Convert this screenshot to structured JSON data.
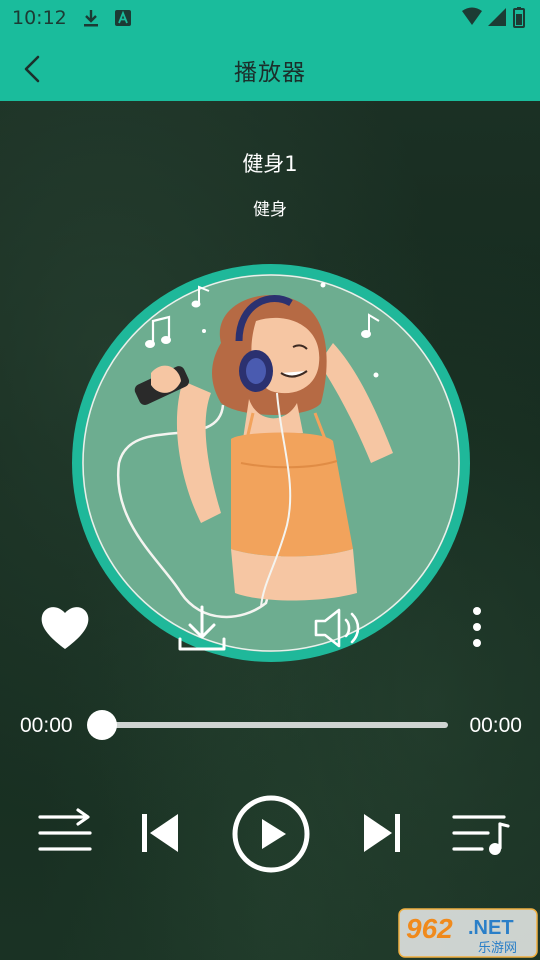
{
  "status_bar": {
    "time": "10:12",
    "icons": [
      "download-icon",
      "a-badge-icon",
      "wifi-icon",
      "signal-icon",
      "battery-icon"
    ]
  },
  "app_bar": {
    "title": "播放器",
    "back_icon": "chevron-left-icon"
  },
  "song": {
    "title": "健身1",
    "artist": "健身"
  },
  "actions": [
    "heart-icon",
    "download-icon",
    "volume-icon",
    "more-vertical-icon"
  ],
  "player": {
    "elapsed": "00:00",
    "total": "00:00",
    "progress": 0,
    "controls": [
      "shuffle-icon",
      "previous-icon",
      "play-icon",
      "next-icon",
      "playlist-icon"
    ]
  },
  "watermark": {
    "number": "962",
    "suffix": ".NET",
    "caption": "乐游网"
  },
  "colors": {
    "accent": "#1abc9c",
    "disc_ring": "#1fb89a",
    "disc_fill": "#6dad90",
    "background": "#16281d",
    "foreground": "#ffffff"
  }
}
